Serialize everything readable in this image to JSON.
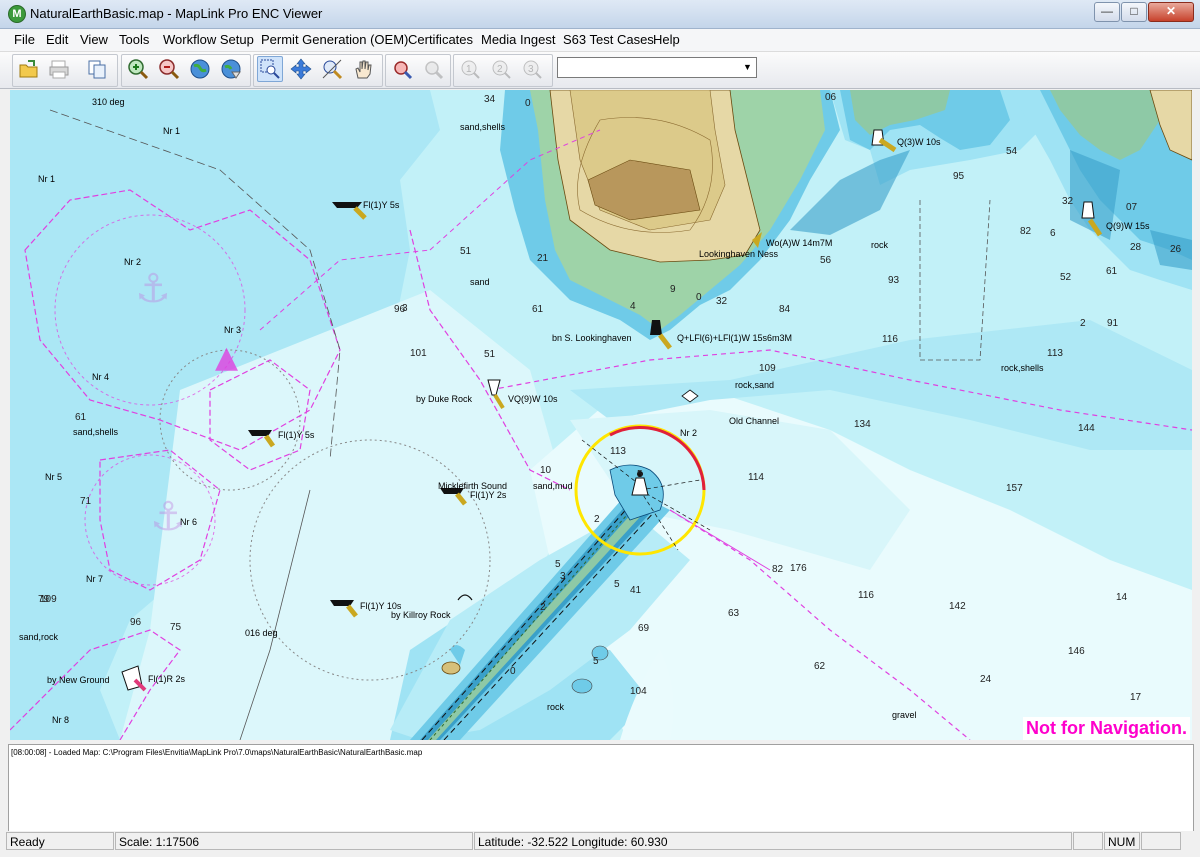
{
  "window": {
    "title": "NaturalEarthBasic.map - MapLink Pro ENC Viewer",
    "app_icon_letter": "M"
  },
  "menu": [
    "File",
    "Edit",
    "View",
    "Tools",
    "Workflow Setup",
    "Permit Generation (OEM)",
    "Certificates",
    "Media Ingest",
    "S63 Test Cases",
    "Help"
  ],
  "toolbar": {
    "combo_value": "",
    "icons": [
      "open-folder-icon",
      "print-icon",
      "copy-icon",
      "zoom-in-icon",
      "zoom-out-icon",
      "globe-icon",
      "globe-refresh-icon",
      "zoom-box-icon",
      "pan-arrows-icon",
      "zoom-tool-icon",
      "hand-icon",
      "find-icon",
      "find-next-icon",
      "view1-icon",
      "view2-icon",
      "view3-icon"
    ]
  },
  "map": {
    "labels": [
      "310 deg",
      "Nr 1",
      "Nr 1",
      "Nr 2",
      "Nr 3",
      "Nr 4",
      "Nr 5",
      "Nr 6",
      "Nr 7",
      "Nr 8",
      "sand,shells",
      "sand,shells",
      "sand",
      "sand,mud",
      "sand,rock",
      "Fl(1)Y 5s",
      "Fl(1)Y 5s",
      "Fl(1)Y 2s",
      "Fl(1)Y 10s",
      "Fl(1)R 2s",
      "by Duke Rock",
      "VQ(9)W 10s",
      "Micklefirth Sound",
      "by Killroy Rock",
      "by New Ground",
      "016 deg",
      "bn S. Lookinghaven",
      "Q+LFl(6)+LFl(1)W 15s6m3M",
      "Lookinghaven Ness",
      "Wo(A)W 14m7M",
      "Q(3)W 10s",
      "Q(9)W 15s",
      "rock",
      "rock,sand",
      "rock,shells",
      "Old Channel",
      "Nr 2",
      "rock",
      "gravel"
    ],
    "depths": [
      "34",
      "0",
      "06",
      "21",
      "4",
      "0",
      "9",
      "32",
      "84",
      "56",
      "93",
      "116",
      "109",
      "113",
      "134",
      "144",
      "114",
      "157",
      "116",
      "142",
      "176",
      "146",
      "82",
      "63",
      "62",
      "14",
      "24",
      "41",
      "69",
      "51",
      "61",
      "101",
      "71",
      "51",
      "79",
      "10",
      "104",
      "113",
      "17",
      "96",
      "95",
      "82",
      "61",
      "91",
      "26",
      "28",
      "07",
      "32",
      "54",
      "5",
      "2",
      "0",
      "5",
      "5",
      "5",
      "3",
      "2",
      "2",
      "52",
      "6",
      "3",
      "96",
      "75",
      "109",
      "61",
      "72",
      "61"
    ],
    "not_for_navigation": "Not for Navigation."
  },
  "log": {
    "line": "[08:00:08] - Loaded Map: C:\\Program Files\\Envitia\\MapLink Pro\\7.0\\maps\\NaturalEarthBasic\\NaturalEarthBasic.map"
  },
  "status": {
    "ready": "Ready",
    "scale": "Scale: 1:17506",
    "coords": "Latitude: -32.522  Longitude: 60.930",
    "num": "NUM"
  },
  "colors": {
    "deep_water": "#c2f1f8",
    "shallow_water": "#9fe3f4",
    "very_shallow": "#6fcbe8",
    "land": "#e6d8a6",
    "drying": "#8ec9a6",
    "nav_magenta": "#e040e0",
    "not_for_nav": "#ff00cc"
  }
}
